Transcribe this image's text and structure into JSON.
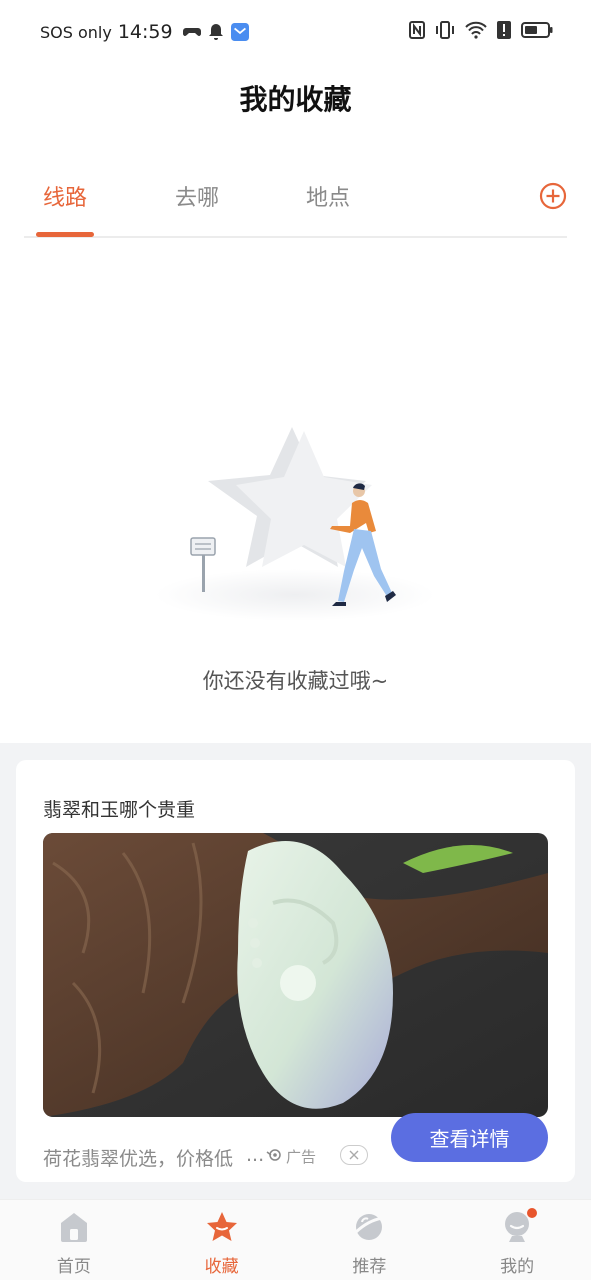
{
  "status_bar": {
    "sos": "SOS only",
    "time": "14:59"
  },
  "header": {
    "title": "我的收藏"
  },
  "tabs": [
    {
      "label": "线路",
      "active": true
    },
    {
      "label": "去哪",
      "active": false
    },
    {
      "label": "地点",
      "active": false
    }
  ],
  "empty_state": {
    "message": "你还没有收藏过哦~"
  },
  "ad": {
    "title": "翡翠和玉哪个贵重",
    "description": "荷花翡翠优选，价格低",
    "ellipsis": "...",
    "tag": "广告",
    "cta": "查看详情"
  },
  "bottom_nav": [
    {
      "label": "首页",
      "icon": "home-icon",
      "active": false
    },
    {
      "label": "收藏",
      "icon": "star-icon",
      "active": true
    },
    {
      "label": "推荐",
      "icon": "planet-icon",
      "active": false
    },
    {
      "label": "我的",
      "icon": "profile-icon",
      "active": false,
      "badge": true
    }
  ],
  "colors": {
    "accent": "#e7663a",
    "cta": "#5b6ee1",
    "badge": "#e8552c"
  }
}
